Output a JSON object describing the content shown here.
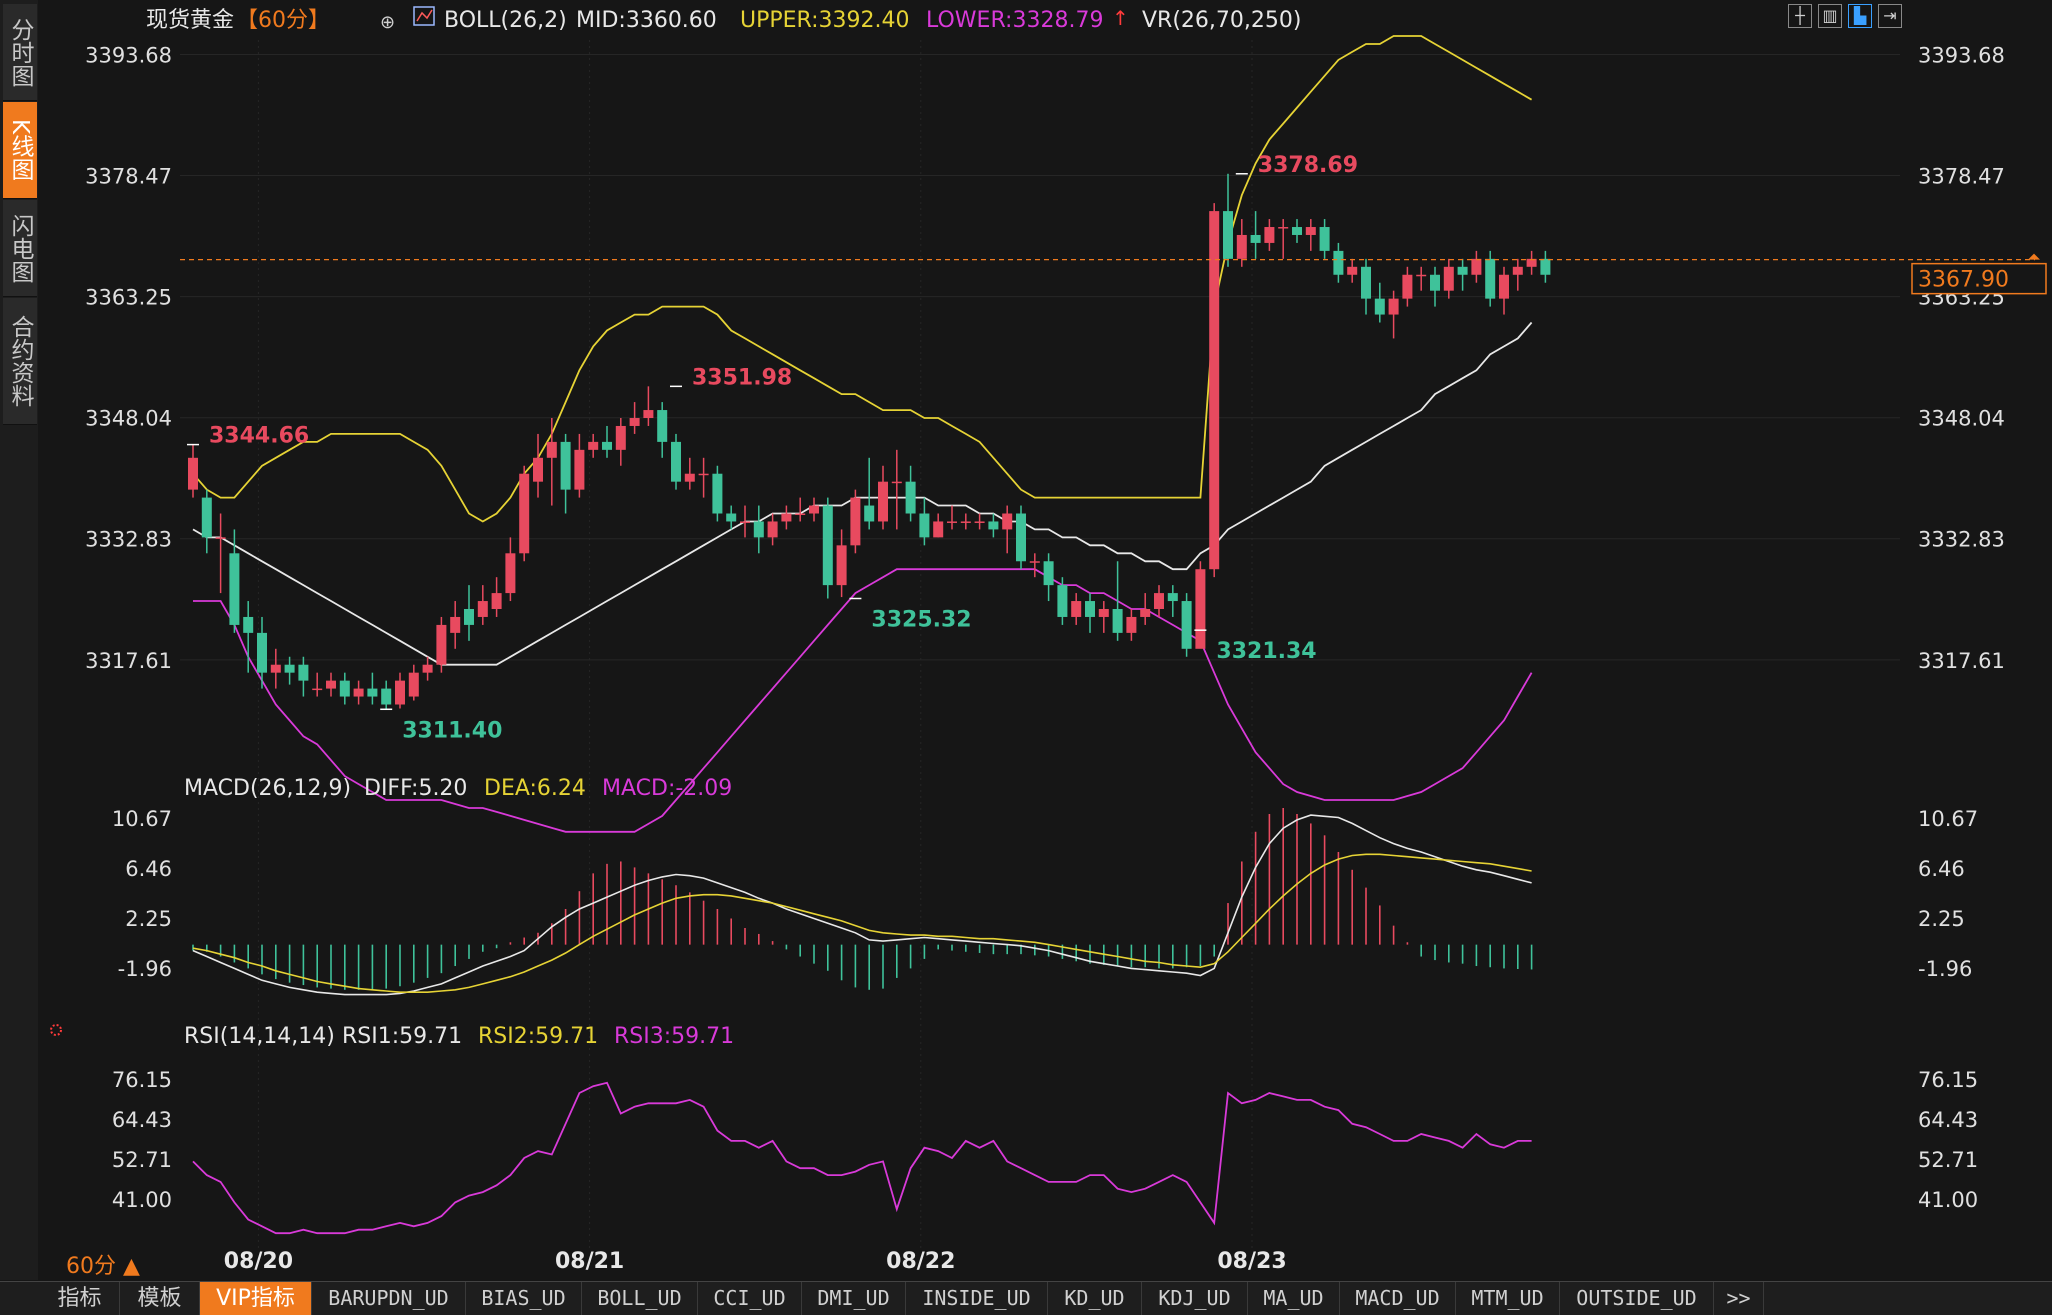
{
  "nav": {
    "tabs": [
      {
        "label": "分时图",
        "active": false
      },
      {
        "label": "K线图",
        "active": true
      },
      {
        "label": "闪电图",
        "active": false
      },
      {
        "label": "合约资料",
        "active": false
      }
    ]
  },
  "header": {
    "title": "现货黄金",
    "period_tag": "【60分】",
    "boll_label": "BOLL(26,2)",
    "mid": "MID:3360.60",
    "upper": "UPPER:3392.40",
    "lower": "LOWER:3328.79",
    "vr": "VR(26,70,250)"
  },
  "toolbar": {
    "icons": [
      "crosshair-icon",
      "chart-layout-icon",
      "chart-active-icon",
      "next-icon"
    ]
  },
  "macd_legend": {
    "name": "MACD(26,12,9)",
    "diff": "DIFF:5.20",
    "dea": "DEA:6.24",
    "macd": "MACD:-2.09"
  },
  "rsi_legend": {
    "name": "RSI(14,14,14)",
    "rsi1": "RSI1:59.71",
    "rsi2": "RSI2:59.71",
    "rsi3": "RSI3:59.71"
  },
  "price_marker": "3367.90",
  "period_label": "60分 ▲",
  "bottom_tabs": [
    {
      "label": "指标",
      "active": false
    },
    {
      "label": "模板",
      "active": false
    },
    {
      "label": "VIP指标",
      "active": true
    },
    {
      "label": "BARUPDN_UD",
      "active": false
    },
    {
      "label": "BIAS_UD",
      "active": false
    },
    {
      "label": "BOLL_UD",
      "active": false
    },
    {
      "label": "CCI_UD",
      "active": false
    },
    {
      "label": "DMI_UD",
      "active": false
    },
    {
      "label": "INSIDE_UD",
      "active": false
    },
    {
      "label": "KD_UD",
      "active": false
    },
    {
      "label": "KDJ_UD",
      "active": false
    },
    {
      "label": "MA_UD",
      "active": false
    },
    {
      "label": "MACD_UD",
      "active": false
    },
    {
      "label": "MTM_UD",
      "active": false
    },
    {
      "label": "OUTSIDE_UD",
      "active": false
    },
    {
      "label": ">>",
      "active": false
    }
  ],
  "colors": {
    "up": "#e84a5f",
    "down": "#3fc29a",
    "upper": "#e6d335",
    "lower": "#d93ad9",
    "mid": "#e8e8e8",
    "accent": "#f07a1e"
  },
  "chart_data": {
    "type": "candlestick",
    "x_labels": [
      "08/20",
      "08/21",
      "08/22",
      "08/23"
    ],
    "x_label_index": [
      3,
      27,
      51,
      75
    ],
    "price_ticks": [
      "3393.68",
      "3378.47",
      "3363.25",
      "3348.04",
      "3332.83",
      "3317.61"
    ],
    "price_range": [
      3300.0,
      3395.5
    ],
    "current_price": 3367.9,
    "annotations": [
      {
        "text": "3344.66",
        "index": 0,
        "price": 3344.66,
        "color": "up"
      },
      {
        "text": "3311.40",
        "index": 14,
        "price": 3311.4,
        "color": "down"
      },
      {
        "text": "3351.98",
        "index": 35,
        "price": 3351.98,
        "color": "up"
      },
      {
        "text": "3325.32",
        "index": 48,
        "price": 3325.32,
        "color": "down"
      },
      {
        "text": "3321.34",
        "index": 73,
        "price": 3321.34,
        "color": "down"
      },
      {
        "text": "3378.69",
        "index": 76,
        "price": 3378.69,
        "color": "up"
      }
    ],
    "candles": [
      [
        3339,
        3343,
        3344.66,
        3338
      ],
      [
        3338,
        3333,
        3339,
        3331
      ],
      [
        3333,
        3333,
        3336,
        3326
      ],
      [
        3331,
        3322,
        3334,
        3321
      ],
      [
        3323,
        3321,
        3325,
        3316
      ],
      [
        3321,
        3316,
        3323,
        3314
      ],
      [
        3316,
        3317,
        3319,
        3314
      ],
      [
        3317,
        3316,
        3318,
        3314.5
      ],
      [
        3317,
        3315,
        3318,
        3313
      ],
      [
        3314,
        3314,
        3316,
        3313
      ],
      [
        3314,
        3315,
        3316,
        3313
      ],
      [
        3315,
        3313,
        3316,
        3312
      ],
      [
        3313,
        3314,
        3315,
        3312
      ],
      [
        3314,
        3313,
        3316,
        3312
      ],
      [
        3314,
        3312,
        3315,
        3311.4
      ],
      [
        3312,
        3315,
        3316,
        3311.5
      ],
      [
        3313,
        3316,
        3317,
        3312.5
      ],
      [
        3316,
        3317,
        3318,
        3315
      ],
      [
        3317,
        3322,
        3323,
        3316
      ],
      [
        3321,
        3323,
        3325,
        3319
      ],
      [
        3324,
        3322,
        3327,
        3320
      ],
      [
        3323,
        3325,
        3327,
        3322
      ],
      [
        3324,
        3326,
        3328,
        3323
      ],
      [
        3326,
        3331,
        3333,
        3325
      ],
      [
        3331,
        3341,
        3342,
        3330
      ],
      [
        3340,
        3343,
        3346,
        3338
      ],
      [
        3343,
        3345,
        3348,
        3337
      ],
      [
        3345,
        3339,
        3346,
        3336
      ],
      [
        3339,
        3344,
        3346,
        3338
      ],
      [
        3344,
        3345,
        3346,
        3343
      ],
      [
        3345,
        3344,
        3347,
        3343
      ],
      [
        3344,
        3347,
        3348,
        3342
      ],
      [
        3347,
        3348,
        3350,
        3346
      ],
      [
        3348,
        3349,
        3351.98,
        3347
      ],
      [
        3349,
        3345,
        3350,
        3343
      ],
      [
        3345,
        3340,
        3346,
        3339
      ],
      [
        3340,
        3341,
        3343,
        3339
      ],
      [
        3341,
        3341,
        3343,
        3338
      ],
      [
        3341,
        3336,
        3342,
        3335
      ],
      [
        3336,
        3335,
        3337,
        3334
      ],
      [
        3335,
        3335,
        3337,
        3333
      ],
      [
        3335,
        3333,
        3337,
        3331
      ],
      [
        3333,
        3335,
        3336,
        3332
      ],
      [
        3335,
        3336,
        3337,
        3334
      ],
      [
        3336,
        3336,
        3338,
        3335
      ],
      [
        3336,
        3337,
        3338,
        3335
      ],
      [
        3337,
        3327,
        3338,
        3325.32
      ],
      [
        3327,
        3332,
        3334,
        3325.5
      ],
      [
        3332,
        3338,
        3339,
        3331
      ],
      [
        3337,
        3335,
        3343,
        3334
      ],
      [
        3335,
        3340,
        3342,
        3334
      ],
      [
        3340,
        3340,
        3344,
        3334
      ],
      [
        3340,
        3336,
        3342,
        3335
      ],
      [
        3336,
        3333,
        3338,
        3332
      ],
      [
        3333,
        3335,
        3336,
        3333
      ],
      [
        3335,
        3335,
        3337,
        3334
      ],
      [
        3335,
        3335,
        3336,
        3334
      ],
      [
        3335,
        3335,
        3336,
        3334
      ],
      [
        3335,
        3334,
        3336,
        3333
      ],
      [
        3334,
        3336,
        3337,
        3331
      ],
      [
        3336,
        3330,
        3337,
        3329
      ],
      [
        3330,
        3330,
        3331,
        3328
      ],
      [
        3330,
        3327,
        3331,
        3325
      ],
      [
        3327,
        3323,
        3328,
        3322
      ],
      [
        3323,
        3325,
        3326,
        3322
      ],
      [
        3325,
        3323,
        3326,
        3321
      ],
      [
        3323,
        3324,
        3325,
        3321
      ],
      [
        3324,
        3321,
        3330,
        3320
      ],
      [
        3321,
        3323,
        3324,
        3320
      ],
      [
        3323,
        3324,
        3326,
        3322
      ],
      [
        3324,
        3326,
        3327,
        3323
      ],
      [
        3326,
        3325,
        3327,
        3323
      ],
      [
        3325,
        3319,
        3326,
        3318
      ],
      [
        3319,
        3329,
        3330,
        3321.34
      ],
      [
        3329,
        3374,
        3375,
        3328
      ],
      [
        3374,
        3368,
        3378.69,
        3367
      ],
      [
        3368,
        3371,
        3373,
        3367
      ],
      [
        3371,
        3370,
        3374,
        3368
      ],
      [
        3370,
        3372,
        3373,
        3369
      ],
      [
        3372,
        3372,
        3373,
        3368
      ],
      [
        3372,
        3371,
        3373,
        3370
      ],
      [
        3371,
        3372,
        3373,
        3369
      ],
      [
        3372,
        3369,
        3373,
        3368
      ],
      [
        3369,
        3366,
        3370,
        3365
      ],
      [
        3366,
        3367,
        3368,
        3365
      ],
      [
        3367,
        3363,
        3368,
        3361
      ],
      [
        3363,
        3361,
        3365,
        3360
      ],
      [
        3361,
        3363,
        3364,
        3358
      ],
      [
        3363,
        3366,
        3367,
        3362
      ],
      [
        3366,
        3366,
        3367,
        3364
      ],
      [
        3366,
        3364,
        3367,
        3362
      ],
      [
        3364,
        3367,
        3368,
        3363
      ],
      [
        3367,
        3366,
        3368,
        3364
      ],
      [
        3366,
        3368,
        3369,
        3365
      ],
      [
        3368,
        3363,
        3369,
        3362
      ],
      [
        3363,
        3366,
        3367,
        3361
      ],
      [
        3366,
        3367,
        3368,
        3364
      ],
      [
        3367,
        3368,
        3369,
        3366
      ],
      [
        3368,
        3366,
        3369,
        3365
      ]
    ],
    "boll_upper": [
      3341,
      3339,
      3338,
      3338,
      3340,
      3342,
      3343,
      3344,
      3345,
      3345,
      3346,
      3346,
      3346,
      3346,
      3346,
      3346,
      3345,
      3344,
      3342,
      3339,
      3336,
      3335,
      3336,
      3338,
      3341,
      3343,
      3346,
      3350,
      3354,
      3357,
      3359,
      3360,
      3361,
      3361,
      3362,
      3362,
      3362,
      3362,
      3361,
      3359,
      3358,
      3357,
      3356,
      3355,
      3354,
      3353,
      3352,
      3351,
      3351,
      3350,
      3349,
      3349,
      3349,
      3348,
      3348,
      3347,
      3346,
      3345,
      3343,
      3341,
      3339,
      3338,
      3338,
      3338,
      3338,
      3338,
      3338,
      3338,
      3338,
      3338,
      3338,
      3338,
      3338,
      3338,
      3362,
      3370,
      3376,
      3380,
      3383,
      3385,
      3387,
      3389,
      3391,
      3393,
      3394,
      3395,
      3395,
      3396,
      3396,
      3396,
      3395,
      3394,
      3393,
      3392,
      3391,
      3390,
      3389,
      3388
    ],
    "boll_mid": [
      3334,
      3333,
      3333,
      3332,
      3331,
      3330,
      3329,
      3328,
      3327,
      3326,
      3325,
      3324,
      3323,
      3322,
      3321,
      3320,
      3319,
      3318,
      3317,
      3317,
      3317,
      3317,
      3317,
      3318,
      3319,
      3320,
      3321,
      3322,
      3323,
      3324,
      3325,
      3326,
      3327,
      3328,
      3329,
      3330,
      3331,
      3332,
      3333,
      3334,
      3335,
      3335,
      3336,
      3336,
      3336,
      3337,
      3337,
      3337,
      3338,
      3338,
      3338,
      3338,
      3338,
      3338,
      3337,
      3337,
      3337,
      3336,
      3336,
      3335,
      3335,
      3334,
      3334,
      3333,
      3333,
      3332,
      3332,
      3331,
      3331,
      3330,
      3330,
      3329,
      3329,
      3331,
      3332,
      3334,
      3335,
      3336,
      3337,
      3338,
      3339,
      3340,
      3342,
      3343,
      3344,
      3345,
      3346,
      3347,
      3348,
      3349,
      3351,
      3352,
      3353,
      3354,
      3356,
      3357,
      3358,
      3360
    ],
    "boll_lower": [
      3325,
      3325,
      3325,
      3322,
      3318,
      3315,
      3312,
      3310,
      3308,
      3307,
      3305,
      3303,
      3302,
      3301,
      3300,
      3300,
      3300,
      3300,
      3300,
      3299.5,
      3299,
      3299,
      3298.5,
      3298,
      3297.5,
      3297,
      3296.5,
      3296,
      3296,
      3296,
      3296,
      3296,
      3296,
      3297,
      3298,
      3300,
      3302,
      3304,
      3306,
      3308,
      3310,
      3312,
      3314,
      3316,
      3318,
      3320,
      3322,
      3324,
      3326,
      3327,
      3328,
      3329,
      3329,
      3329,
      3329,
      3329,
      3329,
      3329,
      3329,
      3329,
      3329,
      3329,
      3328,
      3327,
      3327,
      3326,
      3326,
      3325,
      3324,
      3324,
      3323,
      3322,
      3321,
      3320,
      3316,
      3312,
      3309,
      3306,
      3304,
      3302,
      3301,
      3300.5,
      3300,
      3300,
      3300,
      3300,
      3300,
      3300,
      3300.5,
      3301,
      3302,
      3303,
      3304,
      3306,
      3308,
      3310,
      3313,
      3316
    ],
    "macd_ticks": [
      "10.67",
      "6.46",
      "2.25",
      "-1.96"
    ],
    "macd_range": [
      -5.5,
      11.5
    ],
    "macd_diff": [
      -0.5,
      -1,
      -1.5,
      -2,
      -2.5,
      -3,
      -3.3,
      -3.6,
      -3.8,
      -4,
      -4.1,
      -4.2,
      -4.2,
      -4.2,
      -4.2,
      -4.1,
      -3.9,
      -3.6,
      -3.3,
      -2.8,
      -2.3,
      -1.8,
      -1.4,
      -1,
      -0.5,
      0.5,
      1.5,
      2.3,
      3,
      3.5,
      4,
      4.5,
      5,
      5.4,
      5.7,
      5.9,
      5.8,
      5.6,
      5.2,
      4.8,
      4.4,
      3.9,
      3.5,
      3,
      2.6,
      2.2,
      1.8,
      1.4,
      1,
      0.4,
      0.3,
      0.4,
      0.5,
      0.6,
      0.5,
      0.4,
      0.3,
      0.2,
      0.1,
      0,
      -0.1,
      -0.3,
      -0.5,
      -0.8,
      -1.1,
      -1.4,
      -1.6,
      -1.8,
      -2,
      -2.1,
      -2.2,
      -2.3,
      -2.4,
      -2.6,
      -2,
      1,
      4,
      6.5,
      8.5,
      9.8,
      10.5,
      10.9,
      10.8,
      10.7,
      10.2,
      9.6,
      9,
      8.5,
      8.1,
      7.8,
      7.4,
      7,
      6.6,
      6.3,
      6.1,
      5.8,
      5.5,
      5.2
    ],
    "macd_dea": [
      -0.3,
      -0.5,
      -0.8,
      -1.1,
      -1.5,
      -1.8,
      -2.2,
      -2.5,
      -2.8,
      -3.1,
      -3.3,
      -3.5,
      -3.7,
      -3.8,
      -3.9,
      -4,
      -4,
      -4,
      -3.9,
      -3.8,
      -3.6,
      -3.3,
      -3,
      -2.7,
      -2.3,
      -1.8,
      -1.3,
      -0.7,
      0,
      0.7,
      1.3,
      1.9,
      2.5,
      3,
      3.5,
      3.9,
      4.1,
      4.2,
      4.2,
      4.1,
      3.9,
      3.7,
      3.5,
      3.2,
      2.9,
      2.6,
      2.3,
      2,
      1.6,
      1.2,
      1,
      0.9,
      0.8,
      0.8,
      0.7,
      0.7,
      0.6,
      0.5,
      0.5,
      0.4,
      0.3,
      0.2,
      0,
      -0.2,
      -0.4,
      -0.6,
      -0.8,
      -1,
      -1.2,
      -1.4,
      -1.5,
      -1.7,
      -1.8,
      -1.9,
      -1.6,
      -0.6,
      0.6,
      1.8,
      3,
      4.1,
      5.1,
      6,
      6.7,
      7.2,
      7.5,
      7.6,
      7.6,
      7.5,
      7.4,
      7.3,
      7.2,
      7.1,
      7,
      6.9,
      6.8,
      6.6,
      6.4,
      6.2
    ],
    "macd_hist": [
      -0.5,
      -0.6,
      -1,
      -1.5,
      -2,
      -2.5,
      -2.9,
      -3.2,
      -3.4,
      -3.6,
      -3.7,
      -3.8,
      -3.8,
      -3.8,
      -3.7,
      -3.5,
      -3.2,
      -2.8,
      -2.4,
      -1.8,
      -1.2,
      -0.6,
      -0.3,
      0.2,
      0.6,
      1,
      1.8,
      3,
      4.5,
      6,
      6.8,
      7,
      6.5,
      6,
      5.5,
      5,
      4.4,
      3.7,
      3,
      2.2,
      1.4,
      0.9,
      0.3,
      -0.4,
      -1,
      -1.6,
      -2.2,
      -3,
      -3.6,
      -3.8,
      -3.7,
      -2.8,
      -2,
      -1.2,
      -0.4,
      -0.5,
      -0.6,
      -0.7,
      -0.8,
      -0.8,
      -0.8,
      -0.9,
      -1,
      -1.2,
      -1.4,
      -1.6,
      -1.7,
      -1.8,
      -1.9,
      -1.9,
      -2,
      -2,
      -1.9,
      -1.8,
      -1,
      3.5,
      7,
      9.5,
      11,
      11.5,
      11,
      10.2,
      9.2,
      7.8,
      6.3,
      4.8,
      3.3,
      1.6,
      0.2,
      -1,
      -1.3,
      -1.5,
      -1.6,
      -1.8,
      -1.9,
      -2,
      -2.05,
      -2.09
    ],
    "rsi_ticks": [
      "76.15",
      "64.43",
      "52.71",
      "41.00"
    ],
    "rsi_range": [
      29.0,
      84.0
    ],
    "rsi1": [
      52,
      48,
      46,
      40,
      35,
      33,
      31,
      31,
      32,
      31,
      31,
      31,
      32,
      32,
      33,
      34,
      33,
      34,
      36,
      40,
      42,
      43,
      45,
      48,
      53,
      55,
      54,
      63,
      72,
      74,
      75,
      66,
      68,
      69,
      69,
      69,
      70,
      68,
      61,
      58,
      58,
      56,
      58,
      52,
      50,
      50,
      48,
      48,
      49,
      51,
      52,
      38,
      50,
      56,
      55,
      53,
      58,
      56,
      58,
      52,
      50,
      48,
      46,
      46,
      46,
      48,
      48,
      44,
      43,
      44,
      46,
      48,
      46,
      40,
      34,
      72,
      69,
      70,
      72,
      71,
      70,
      70,
      68,
      67,
      63,
      62,
      60,
      58,
      58,
      60,
      59,
      58,
      56,
      60,
      57,
      56,
      58,
      58
    ],
    "rsi2_offset_note": ""
  }
}
